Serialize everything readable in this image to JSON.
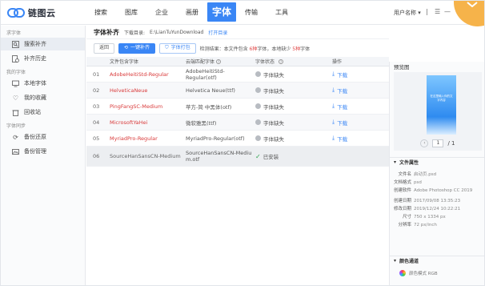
{
  "app": {
    "name": "链图云"
  },
  "nav": {
    "items": [
      "搜索",
      "图库",
      "企业",
      "画册",
      "字体",
      "传输",
      "工具"
    ]
  },
  "topbar": {
    "user": "用户名称 ▾"
  },
  "sidebar": {
    "groups": [
      {
        "label": "求字体",
        "items": [
          {
            "label": "搜索补齐",
            "icon": "search-scan-icon"
          },
          {
            "label": "补齐历史",
            "icon": "history-icon"
          }
        ]
      },
      {
        "label": "我的字体",
        "items": [
          {
            "label": "本地字体",
            "icon": "monitor-icon"
          },
          {
            "label": "我的收藏",
            "icon": "heart-icon"
          },
          {
            "label": "回收站",
            "icon": "trash-icon"
          }
        ]
      },
      {
        "label": "字体同步",
        "items": [
          {
            "label": "备份还原",
            "icon": "sync-icon"
          },
          {
            "label": "备份管理",
            "icon": "image-icon"
          }
        ]
      }
    ]
  },
  "main": {
    "title": "字体补齐",
    "dir_label": "下载目录:",
    "dir_path": "E:\\LianTuYunDownload",
    "dir_link": "打开目录",
    "toolbar": {
      "back": "返回",
      "one_click": "一键补齐",
      "pack": "字体打包",
      "check_prefix": "检测结果：本文件包含",
      "total": "6种",
      "check_mid": "字体，本地缺少",
      "missing": "5种",
      "check_suffix": "字体"
    },
    "columns": [
      "",
      "文件包含字体",
      "云端匹配字体",
      "字体状态",
      "操作"
    ],
    "rows": [
      {
        "idx": "01",
        "font": "AdobeHeitiStd-Regular",
        "match": "AdobeHeitiStd-Regular(otf)",
        "status": "字体缺失",
        "op": "下载",
        "missing": true
      },
      {
        "idx": "02",
        "font": "HelveticaNeue",
        "match": "Helvetica Neue(ttf)",
        "status": "字体缺失",
        "op": "下载",
        "missing": true
      },
      {
        "idx": "03",
        "font": "PingFangSC-Medium",
        "match": "苹方-简 中黑体(otf)",
        "status": "字体缺失",
        "op": "下载",
        "missing": true
      },
      {
        "idx": "04",
        "font": "MicrosoftYaHei",
        "match": "微软雅黑(ttf)",
        "status": "字体缺失",
        "op": "下载",
        "missing": true
      },
      {
        "idx": "05",
        "font": "MyriadPro-Regular",
        "match": "MyriadPro-Regular(otf)",
        "status": "字体缺失",
        "op": "下载",
        "missing": true
      },
      {
        "idx": "06",
        "font": "SourceHanSansCN-Medium",
        "match": "SourceHanSansCN-Medium.otf",
        "status": "已安装",
        "op": "",
        "missing": false
      }
    ]
  },
  "preview": {
    "title": "预览图",
    "phone_text": "在这里输入你的文字内容",
    "page_current": "1",
    "page_total": "/ 1"
  },
  "file_props": {
    "title": "文件属性",
    "items": [
      {
        "k": "文件名",
        "v": "启动页.psd"
      },
      {
        "k": "文档格式",
        "v": "psd"
      },
      {
        "k": "创建软件",
        "v": "Adobe Photoshop CC 2019"
      },
      {
        "k": "创建日期",
        "v": "2017/09/08 13:35:23"
      },
      {
        "k": "修改日期",
        "v": "2019/12/24 10:22:21"
      },
      {
        "k": "尺寸",
        "v": "750 x 1334 px"
      },
      {
        "k": "分辨率",
        "v": "72 px/inch"
      }
    ]
  },
  "color_channel": {
    "title": "颜色通道",
    "mode": "颜色模式 RGB"
  },
  "colors": {
    "accent": "#3a86f5",
    "missing_font": "#d93a3a",
    "installed": "#2da44e",
    "badge": "#f6b34a"
  }
}
